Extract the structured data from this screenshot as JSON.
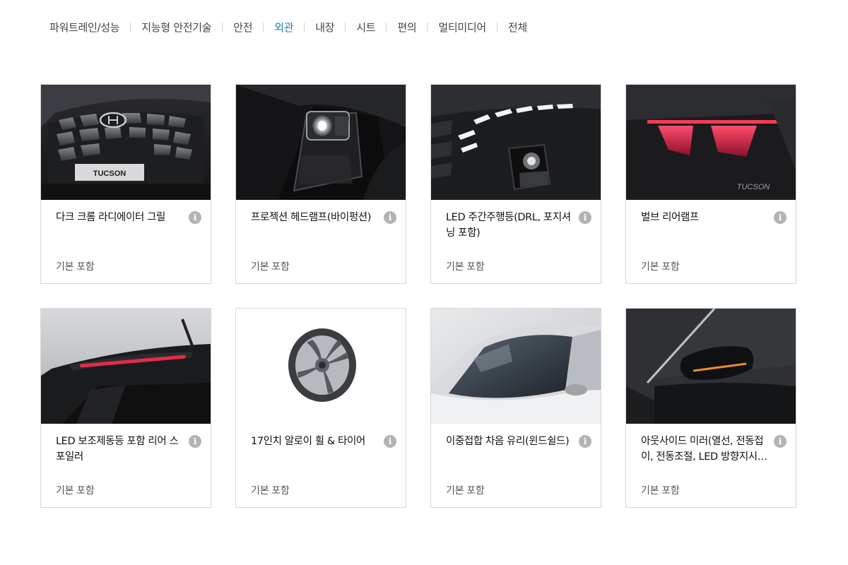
{
  "tabs": [
    {
      "label": "파워트레인/성능",
      "active": false
    },
    {
      "label": "지능형 안전기술",
      "active": false
    },
    {
      "label": "안전",
      "active": false
    },
    {
      "label": "외관",
      "active": true
    },
    {
      "label": "내장",
      "active": false
    },
    {
      "label": "시트",
      "active": false
    },
    {
      "label": "편의",
      "active": false
    },
    {
      "label": "멀티미디어",
      "active": false
    },
    {
      "label": "전체",
      "active": false
    }
  ],
  "cards": [
    {
      "title": "다크 크롬 라디에이터 그릴",
      "status": "기본 포함",
      "image": "grille",
      "badge": "TUCSON"
    },
    {
      "title": "프로젝션 헤드램프(바이펑션)",
      "status": "기본 포함",
      "image": "headlamp"
    },
    {
      "title": "LED 주간주행등(DRL, 포지셔닝 포함)",
      "status": "기본 포함",
      "image": "drl"
    },
    {
      "title": "벌브 리어램프",
      "status": "기본 포함",
      "image": "rearlamp",
      "badge": "TUCSON"
    },
    {
      "title": "LED 보조제동등 포함 리어 스포일러",
      "status": "기본 포함",
      "image": "spoiler"
    },
    {
      "title": "17인치 알로이 휠 & 타이어",
      "status": "기본 포함",
      "image": "wheel"
    },
    {
      "title": "이중접합 차음 유리(윈드쉴드)",
      "status": "기본 포함",
      "image": "windshield"
    },
    {
      "title": "아웃사이드 미러(열선, 전동접이, 전동조절, LED 방향지시…",
      "status": "기본 포함",
      "image": "mirror"
    }
  ],
  "info_symbol": "i"
}
